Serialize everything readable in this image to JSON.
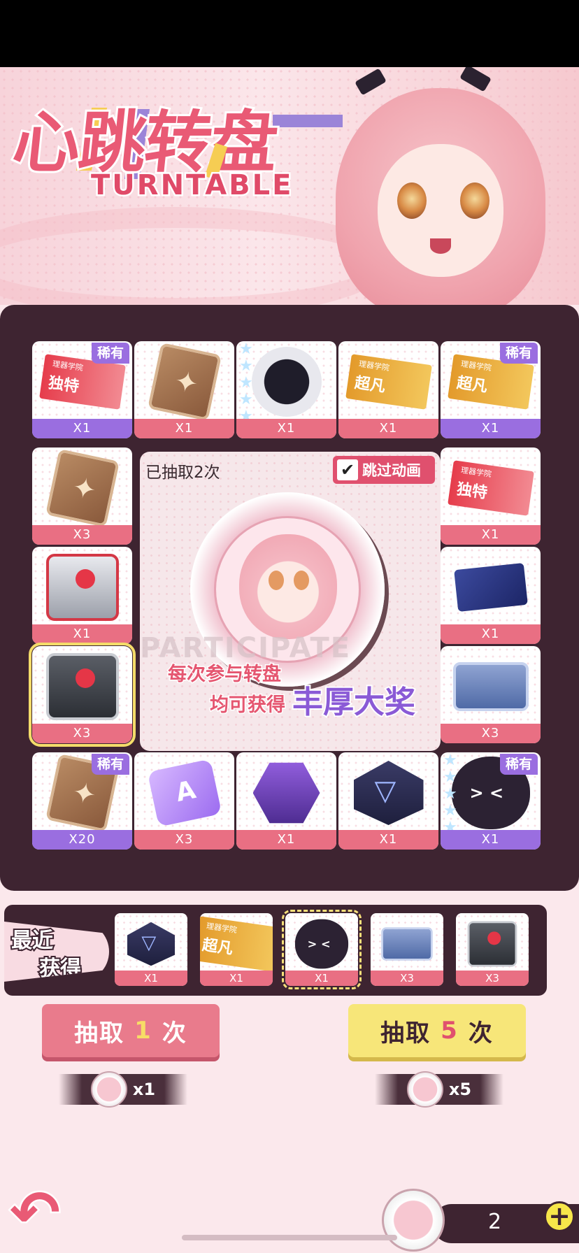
{
  "title": {
    "cn": "心跳转盘",
    "en": "TURNTABLE"
  },
  "grid": [
    {
      "qty": "X1",
      "rare": true,
      "art": "ticket-red",
      "ticket_label": "独特",
      "ticket_small": "理器学院"
    },
    {
      "qty": "X1",
      "rare": false,
      "art": "card"
    },
    {
      "qty": "X1",
      "rare": false,
      "art": "robot",
      "stars": true
    },
    {
      "qty": "X1",
      "rare": false,
      "art": "ticket-gold",
      "ticket_label": "超凡",
      "ticket_small": "理器学院"
    },
    {
      "qty": "X1",
      "rare": true,
      "art": "ticket-gold",
      "ticket_label": "超凡",
      "ticket_small": "理器学院"
    },
    {
      "qty": "X3",
      "rare": false,
      "art": "card"
    },
    {
      "qty": "X1",
      "rare": false,
      "art": "ticket-red",
      "ticket_label": "独特",
      "ticket_small": "理器学院"
    },
    {
      "qty": "X1",
      "rare": false,
      "art": "crate-red"
    },
    {
      "qty": "X1",
      "rare": false,
      "art": "folder"
    },
    {
      "qty": "X3",
      "rare": false,
      "art": "crate",
      "selected": true
    },
    {
      "qty": "X3",
      "rare": false,
      "art": "case"
    },
    {
      "qty": "X20",
      "rare": true,
      "art": "card"
    },
    {
      "qty": "X3",
      "rare": false,
      "art": "lilac"
    },
    {
      "qty": "X1",
      "rare": false,
      "art": "hex"
    },
    {
      "qty": "X1",
      "rare": false,
      "art": "tri"
    },
    {
      "qty": "X1",
      "rare": true,
      "art": "blob",
      "stars": true
    }
  ],
  "rare_tag": "稀有",
  "center": {
    "draw_count": "已抽取2次",
    "skip_label": "跳过动画",
    "skip_checked": "✔",
    "watermark": "PARTICIPATE",
    "slogan_1": "每次参与转盘",
    "slogan_2": "均可获得",
    "slogan_3": "丰厚大奖"
  },
  "recent": {
    "label_1": "最近",
    "label_2": "获得",
    "items": [
      {
        "qty": "X1",
        "art": "tri"
      },
      {
        "qty": "X1",
        "art": "ticket-gold",
        "ticket_label": "超凡",
        "ticket_small": "理器学院"
      },
      {
        "qty": "X1",
        "art": "blob",
        "highlight": true
      },
      {
        "qty": "X3",
        "art": "case"
      },
      {
        "qty": "X3",
        "art": "crate"
      }
    ]
  },
  "buttons": {
    "draw_one": {
      "prefix": "抽取",
      "num": "1",
      "suffix": "次",
      "cost": "x1"
    },
    "draw_five": {
      "prefix": "抽取",
      "num": "5",
      "suffix": "次",
      "cost": "x5"
    }
  },
  "wallet": {
    "value": "2",
    "plus": "+"
  },
  "colors": {
    "board": "#3e2431",
    "qty_bar": "#e96f83",
    "rare_bar": "#9a6ee0",
    "accent": "#e95a75",
    "yellow": "#f7e679"
  }
}
